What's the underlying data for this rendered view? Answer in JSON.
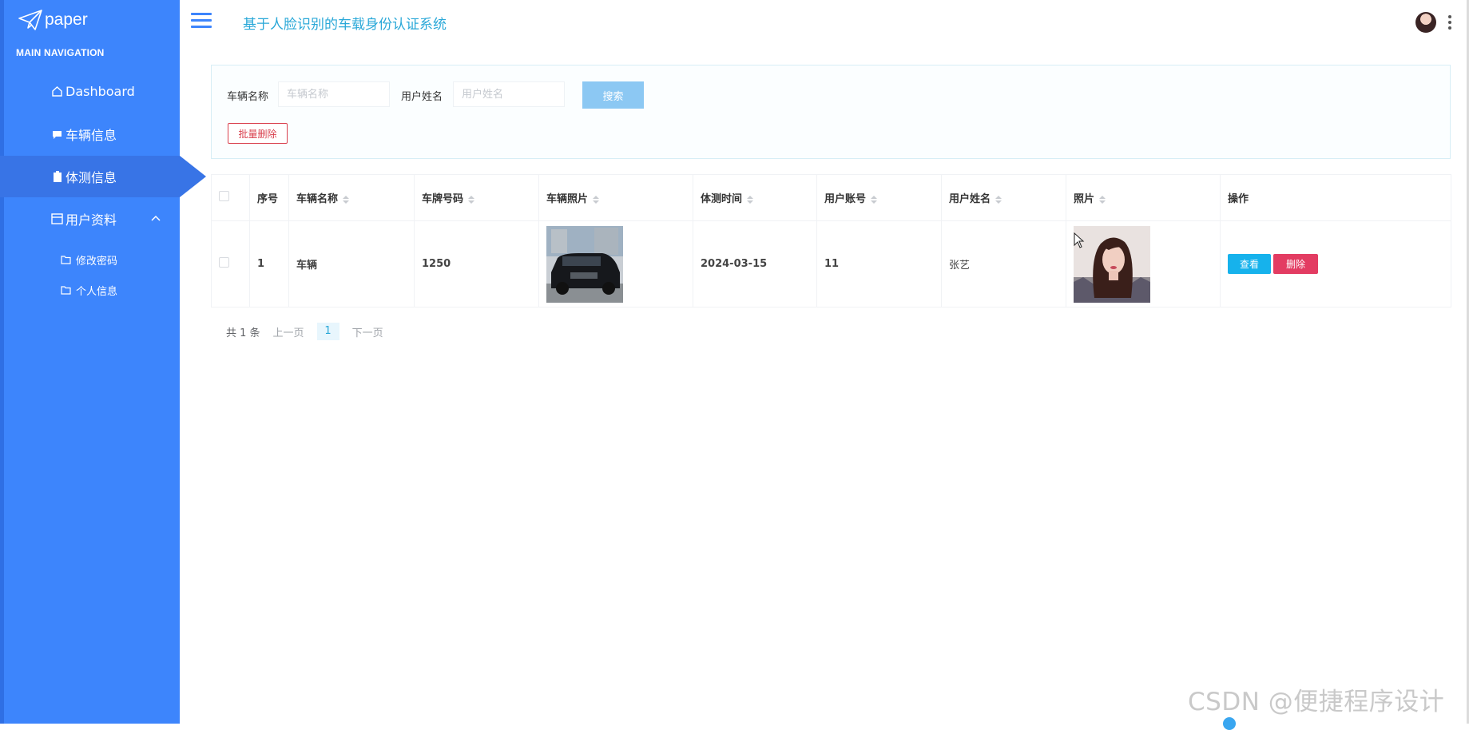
{
  "brand": {
    "name": "paper"
  },
  "sidebar": {
    "section_title": "MAIN NAVIGATION",
    "items": [
      {
        "label": "Dashboard",
        "icon": "home-icon"
      },
      {
        "label": "车辆信息",
        "icon": "comment-icon"
      },
      {
        "label": "体测信息",
        "icon": "clipboard-icon",
        "active": true
      },
      {
        "label": "用户资料",
        "icon": "card-icon",
        "expanded": true
      }
    ],
    "sub_items": [
      {
        "label": "修改密码",
        "icon": "folder-icon"
      },
      {
        "label": "个人信息",
        "icon": "folder-icon"
      }
    ]
  },
  "header": {
    "title": "基于人脸识别的车载身份认证系统"
  },
  "search": {
    "vehicle_label": "车辆名称",
    "vehicle_placeholder": "车辆名称",
    "user_label": "用户姓名",
    "user_placeholder": "用户姓名",
    "search_button": "搜索",
    "batch_delete_button": "批量删除"
  },
  "table": {
    "columns": [
      "序号",
      "车辆名称",
      "车牌号码",
      "车辆照片",
      "体测时间",
      "用户账号",
      "用户姓名",
      "照片",
      "操作"
    ],
    "rows": [
      {
        "index": "1",
        "vehicle_name": "车辆",
        "plate": "1250",
        "time": "2024-03-15",
        "account": "11",
        "user_name": "张艺",
        "view": "查看",
        "delete": "删除"
      }
    ]
  },
  "pagination": {
    "total": "共 1 条",
    "prev": "上一页",
    "page": "1",
    "next": "下一页"
  },
  "watermark": "CSDN @便捷程序设计",
  "colors": {
    "sidebar": "#3d85fc",
    "title": "#2aa8d8",
    "view": "#16b2ec",
    "delete": "#e33c62",
    "search": "#8cc8f3"
  }
}
